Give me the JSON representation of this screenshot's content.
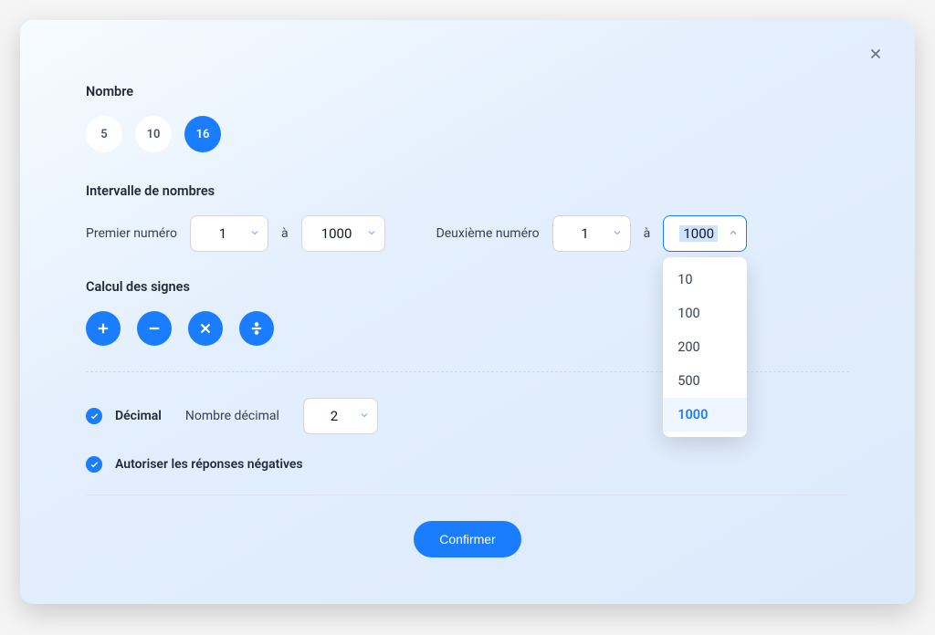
{
  "close_label": "Close",
  "nombre": {
    "title": "Nombre",
    "options": [
      "5",
      "10",
      "16"
    ],
    "selected": "16"
  },
  "interval": {
    "title": "Intervalle de nombres",
    "first_label": "Premier numéro",
    "second_label": "Deuxième numéro",
    "a": "à",
    "first_from": "1",
    "first_to": "1000",
    "second_from": "1",
    "second_to": "1000",
    "second_to_options": [
      "10",
      "100",
      "200",
      "500",
      "1000"
    ],
    "second_to_selected": "1000"
  },
  "signs": {
    "title": "Calcul des signes",
    "items": [
      "plus",
      "minus",
      "multiply",
      "divide"
    ]
  },
  "decimal": {
    "checked": true,
    "label": "Décimal",
    "sub_label": "Nombre décimal",
    "value": "2"
  },
  "negative": {
    "checked": true,
    "label": "Autoriser les réponses négatives"
  },
  "confirm": "Confirmer"
}
